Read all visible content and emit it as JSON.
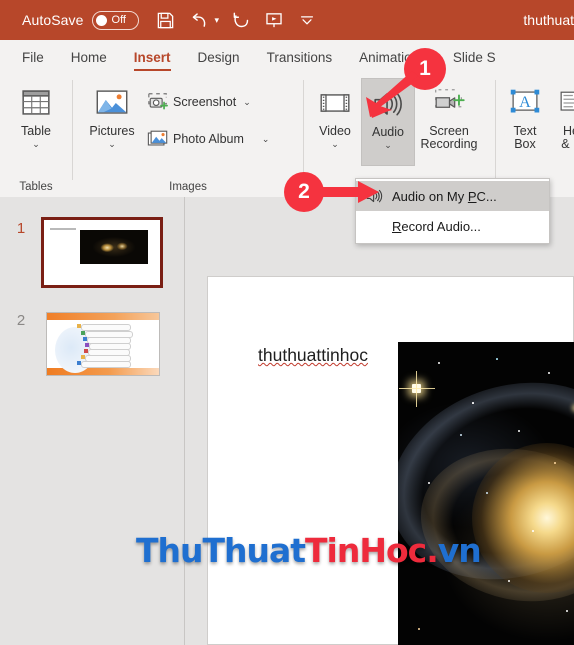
{
  "titlebar": {
    "autosave_label": "AutoSave",
    "autosave_state": "Off",
    "save_icon": "save-icon",
    "undo_icon": "undo-icon",
    "redo_icon": "redo-icon",
    "present_icon": "start-presentation-icon",
    "customize_icon": "customize-quick-access-toolbar-icon",
    "document_title": "thuthuat",
    "background_color": "#b7472a"
  },
  "tabs": [
    {
      "label": "File",
      "active": false
    },
    {
      "label": "Home",
      "active": false
    },
    {
      "label": "Insert",
      "active": true
    },
    {
      "label": "Design",
      "active": false
    },
    {
      "label": "Transitions",
      "active": false
    },
    {
      "label": "Animations",
      "active": false
    },
    {
      "label": "Slide S",
      "active": false
    }
  ],
  "ribbon": {
    "groups": [
      {
        "name": "tables",
        "label": "Tables"
      },
      {
        "name": "images",
        "label": "Images"
      },
      {
        "name": "media",
        "label": ""
      },
      {
        "name": "text",
        "label": ""
      }
    ],
    "table_button": {
      "label": "Table",
      "chevron": "⌄",
      "icon": "table-icon"
    },
    "pictures_button": {
      "label": "Pictures",
      "chevron": "⌄",
      "icon": "pictures-icon"
    },
    "screenshot_button": {
      "label": "Screenshot",
      "chevron": "⌄",
      "icon": "screenshot-icon"
    },
    "photo_album_button": {
      "label": "Photo Album",
      "chevron": "⌄",
      "icon": "photo-album-icon"
    },
    "video_button": {
      "label": "Video",
      "chevron": "⌄",
      "icon": "video-icon"
    },
    "audio_button": {
      "label": "Audio",
      "chevron": "⌄",
      "icon": "audio-icon",
      "selected": true
    },
    "screen_recording_button": {
      "label_line1": "Screen",
      "label_line2": "Recording",
      "icon": "screen-recording-icon"
    },
    "text_box_button": {
      "label_line1": "Text",
      "label_line2": "Box",
      "icon": "text-box-icon"
    },
    "header_footer_button": {
      "label_line1": "He",
      "label_line2": "& F",
      "icon": "header-footer-icon"
    }
  },
  "audio_menu": {
    "items": [
      {
        "text_before": "Audio on My ",
        "accesskey": "P",
        "text_after": "C...",
        "icon": "audio-icon",
        "highlighted": true
      },
      {
        "text_before": "",
        "accesskey": "R",
        "text_after": "ecord Audio...",
        "icon": "",
        "highlighted": false
      }
    ]
  },
  "thumbnails": [
    {
      "number": "1",
      "selected": true
    },
    {
      "number": "2",
      "selected": false
    }
  ],
  "slide": {
    "text": "thuthuattinhoc",
    "image_alt": "galaxy-image"
  },
  "watermark": {
    "part_blue_1": "ThuThuat",
    "part_red": "TinHoc.",
    "part_blue_2": "vn",
    "blue": "#1f6fd0",
    "red": "#ee2b3c"
  },
  "annotations": [
    {
      "number": "1",
      "color": "#f5333f",
      "direction": "down-left"
    },
    {
      "number": "2",
      "color": "#f5333f",
      "direction": "right"
    }
  ]
}
